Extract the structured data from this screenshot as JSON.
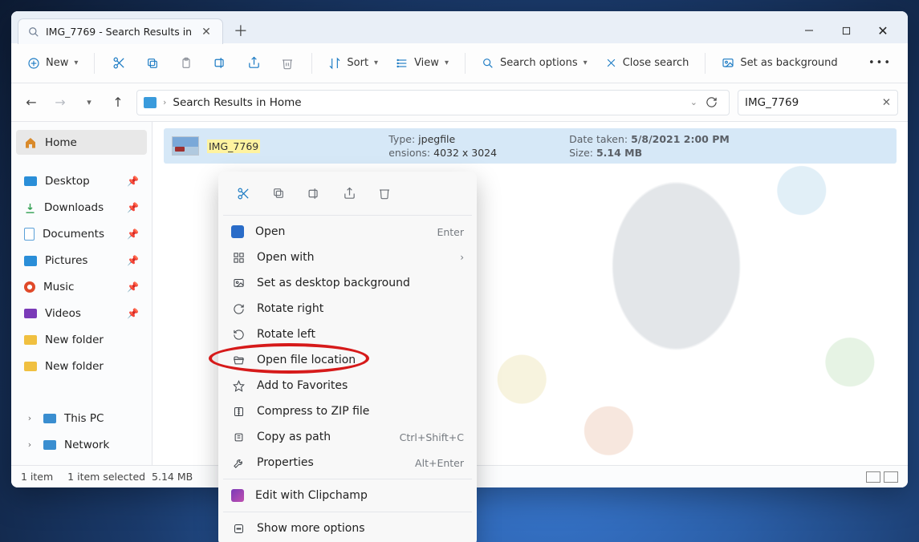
{
  "tab": {
    "title": "IMG_7769 - Search Results in"
  },
  "toolbar": {
    "new": "New",
    "sort": "Sort",
    "view": "View",
    "search_options": "Search options",
    "close_search": "Close search",
    "set_bg": "Set as background"
  },
  "address": {
    "crumb": "Search Results in Home"
  },
  "search": {
    "value": "IMG_7769"
  },
  "sidebar": {
    "home": "Home",
    "items": [
      {
        "label": "Desktop"
      },
      {
        "label": "Downloads"
      },
      {
        "label": "Documents"
      },
      {
        "label": "Pictures"
      },
      {
        "label": "Music"
      },
      {
        "label": "Videos"
      },
      {
        "label": "New folder"
      },
      {
        "label": "New folder"
      }
    ],
    "thispc": "This PC",
    "network": "Network"
  },
  "result": {
    "name": "IMG_7769",
    "type_label": "Type:",
    "type": "jpegfile",
    "dim_label": "ensions:",
    "dim": "4032 x 3024",
    "date_label": "Date taken:",
    "date": "5/8/2021 2:00 PM",
    "size_label": "Size:",
    "size": "5.14 MB"
  },
  "ctx": {
    "open": "Open",
    "open_accel": "Enter",
    "openwith": "Open with",
    "setbg": "Set as desktop background",
    "rot_r": "Rotate right",
    "rot_l": "Rotate left",
    "openloc": "Open file location",
    "fav": "Add to Favorites",
    "zip": "Compress to ZIP file",
    "copypath": "Copy as path",
    "copypath_accel": "Ctrl+Shift+C",
    "props": "Properties",
    "props_accel": "Alt+Enter",
    "clipchamp": "Edit with Clipchamp",
    "more": "Show more options"
  },
  "status": {
    "count": "1 item",
    "selected": "1 item selected",
    "size": "5.14 MB"
  }
}
